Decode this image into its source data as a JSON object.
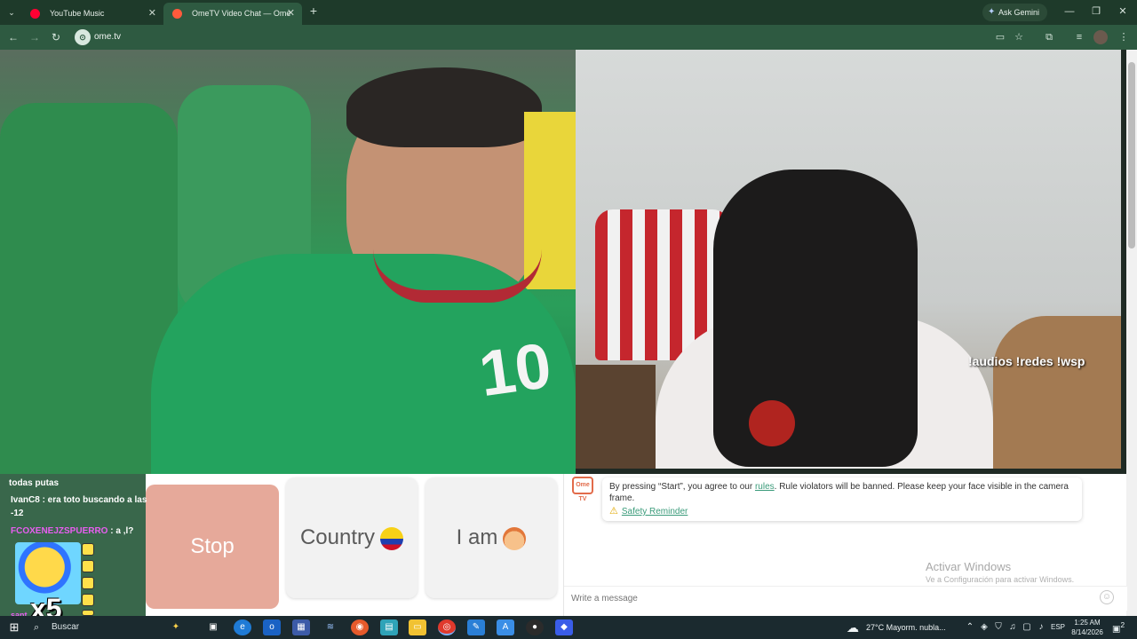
{
  "browser": {
    "tabs": [
      {
        "title": "YouTube Music",
        "favicon": "youtube-music-icon",
        "color": "#ff0033"
      },
      {
        "title": "OmeTV Video Chat — Ome",
        "favicon": "ometv-icon",
        "color": "#ff5a3c",
        "active": true
      }
    ],
    "ask_gemini": "Ask Gemini",
    "url": "ome.tv"
  },
  "video": {
    "overlay_text": "!audios  !redes  !wsp"
  },
  "controls": {
    "stop": "Stop",
    "country": "Country",
    "iam": "I am"
  },
  "chat": {
    "logo": "Ome TV",
    "notice_before": "By pressing “Start”, you agree to our ",
    "rules_link": "rules",
    "notice_after": ". Rule violators will be banned. Please keep your face visible in the camera frame.",
    "safety_reminder": "Safety Reminder",
    "placeholder": "Write a message",
    "activate_title": "Activar Windows",
    "activate_sub": "Ve a Configuración para activar Windows."
  },
  "stream_chat": {
    "lines": [
      {
        "text": "todas putas"
      },
      {
        "text": "IvanC8 : era toto buscando a las"
      },
      {
        "text": "-12"
      },
      {
        "name": "FCOXENEJZSPUERRO",
        "text": " : a ,l?"
      }
    ],
    "badge": "x5",
    "partial_name": "sant"
  },
  "taskbar": {
    "search": "Buscar",
    "weather_temp": "27°C",
    "weather_desc": "Mayorm. nubla...",
    "lang": "ESP",
    "time": "1:25 AM",
    "date": "8/14/2026",
    "notif_count": "2"
  }
}
